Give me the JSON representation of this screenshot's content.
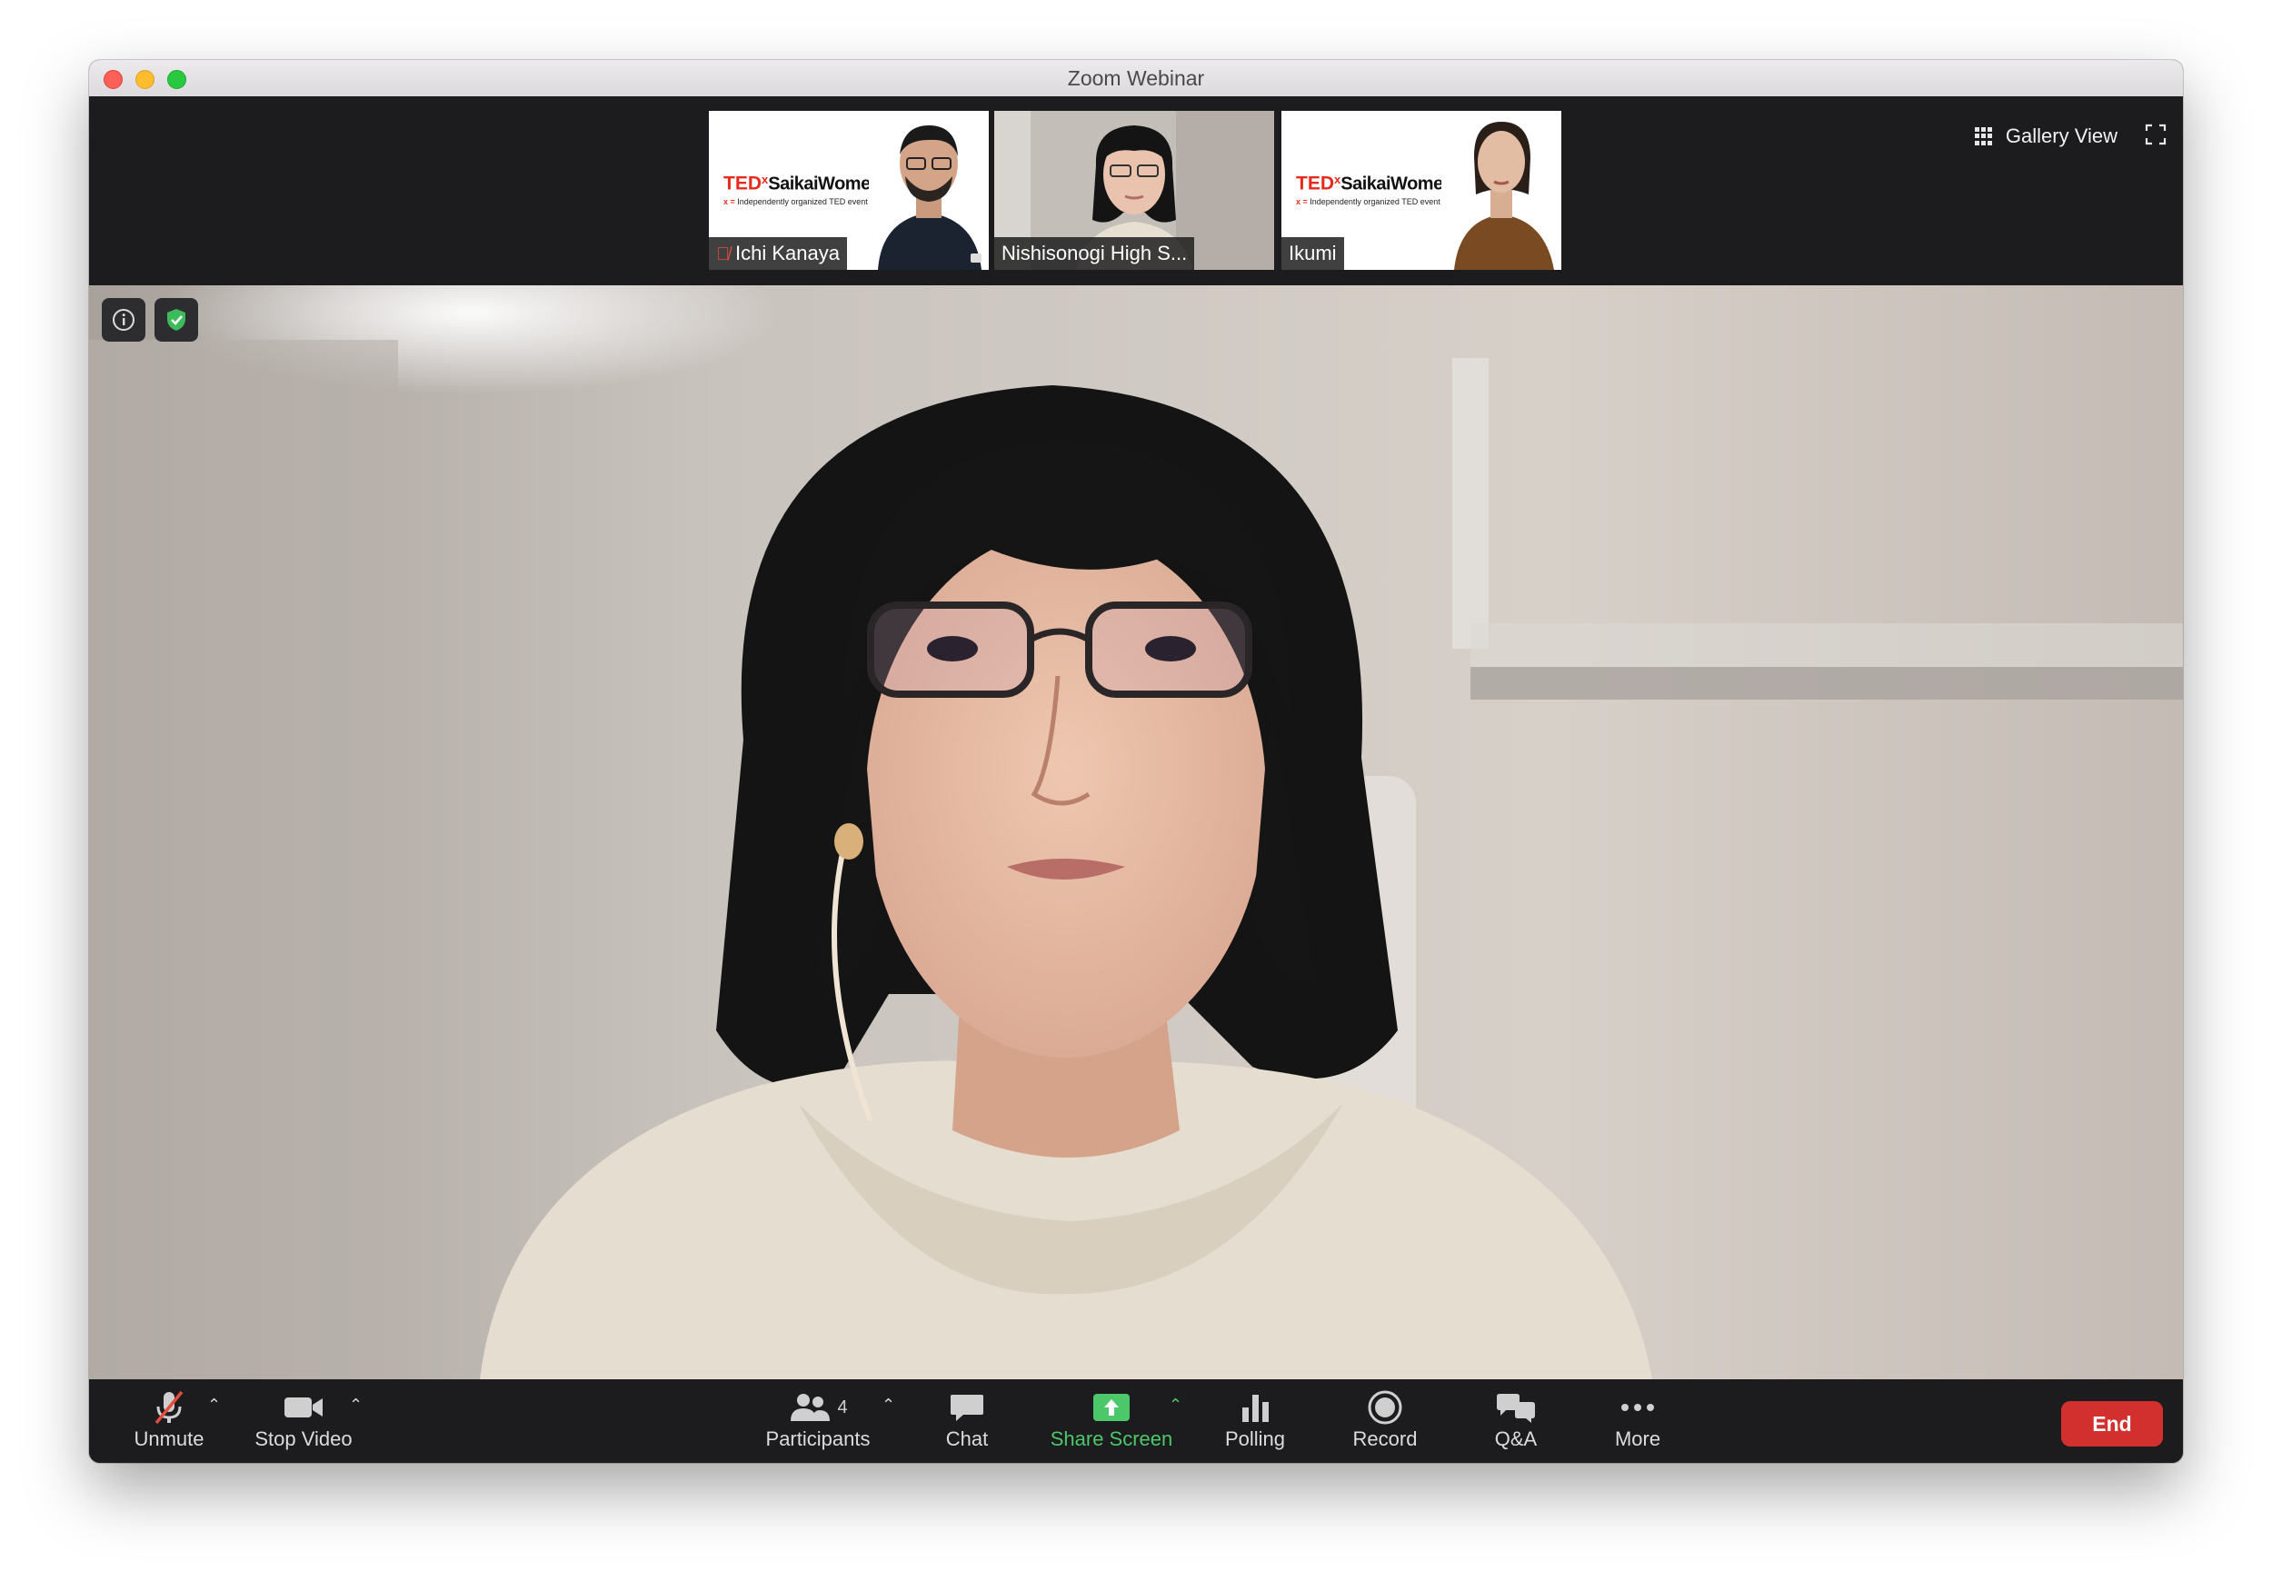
{
  "window": {
    "title": "Zoom Webinar"
  },
  "participants_strip": [
    {
      "name": "Ichi Kanaya",
      "muted": true,
      "logo_text": "TED",
      "logo_x": "x",
      "logo_org": "SaikaiWomen",
      "logo_sub": "Independently organized TED event"
    },
    {
      "name": "Nishisonogi High S...",
      "muted": false,
      "active": true
    },
    {
      "name": "Ikumi",
      "muted": false,
      "logo_text": "TED",
      "logo_x": "x",
      "logo_org": "SaikaiWomen",
      "logo_sub": "Independently organized TED event"
    }
  ],
  "view": {
    "gallery_label": "Gallery View"
  },
  "toolbar": {
    "unmute": "Unmute",
    "stop_video": "Stop Video",
    "participants": "Participants",
    "participants_count": "4",
    "chat": "Chat",
    "share_screen": "Share Screen",
    "polling": "Polling",
    "record": "Record",
    "qa": "Q&A",
    "more": "More",
    "end": "End"
  },
  "colors": {
    "share_green": "#4cc76a",
    "end_red": "#d22f2f",
    "active_speaker_border": "#c8d87a",
    "muted_red": "#e24d3d",
    "shield_green": "#3dbb5c"
  }
}
